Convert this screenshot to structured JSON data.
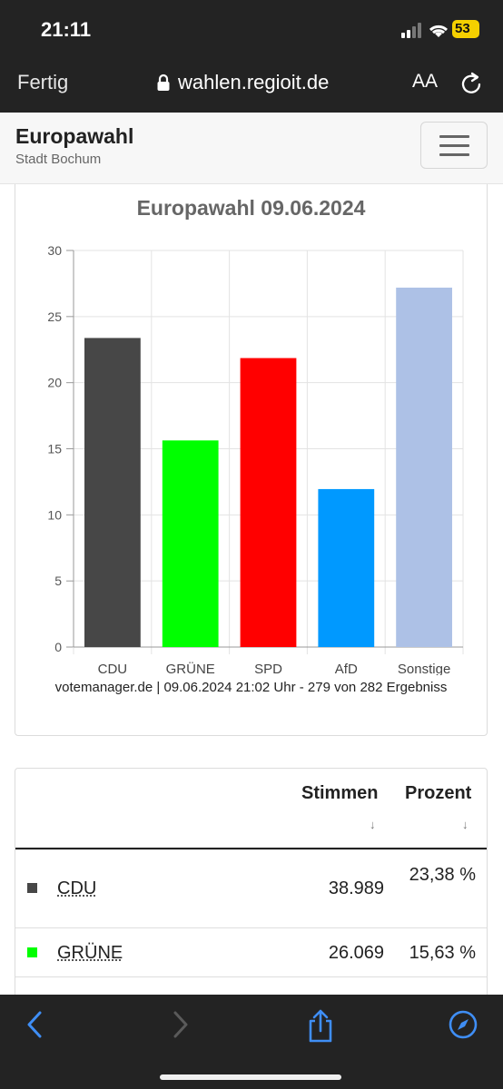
{
  "status_bar": {
    "time": "21:11",
    "battery": "53"
  },
  "browser": {
    "done_label": "Fertig",
    "url": "wahlen.regioit.de",
    "text_size_label": "AA"
  },
  "site": {
    "title": "Europawahl",
    "subtitle": "Stadt Bochum"
  },
  "chart_data": {
    "type": "bar",
    "title": "Europawahl 09.06.2024",
    "categories": [
      "CDU",
      "GRÜNE",
      "SPD",
      "AfD",
      "Sonstige"
    ],
    "category_pct_labels": [
      "23,38 %",
      "15,63 %",
      "21,86 %",
      "11,95 %",
      "27,19 %"
    ],
    "values": [
      23.38,
      15.63,
      21.86,
      11.95,
      27.19
    ],
    "colors": [
      "#474747",
      "#00ff00",
      "#ff0000",
      "#0099ff",
      "#adc1e6"
    ],
    "ylim": [
      0,
      30
    ],
    "yticks": [
      0,
      5,
      10,
      15,
      20,
      25,
      30
    ],
    "grid": true
  },
  "chart_source": "votemanager.de | 09.06.2024 21:02 Uhr - 279 von 282 Ergebniss",
  "table": {
    "headers": {
      "votes": "Stimmen",
      "percent": "Prozent"
    },
    "sort_glyph": "↓",
    "rows": [
      {
        "party": "CDU",
        "votes": "38.989",
        "percent": "23,38 %",
        "color": "#474747"
      },
      {
        "party": "GRÜNE",
        "votes": "26.069",
        "percent": "15,63 %",
        "color": "#00ff00"
      }
    ]
  }
}
